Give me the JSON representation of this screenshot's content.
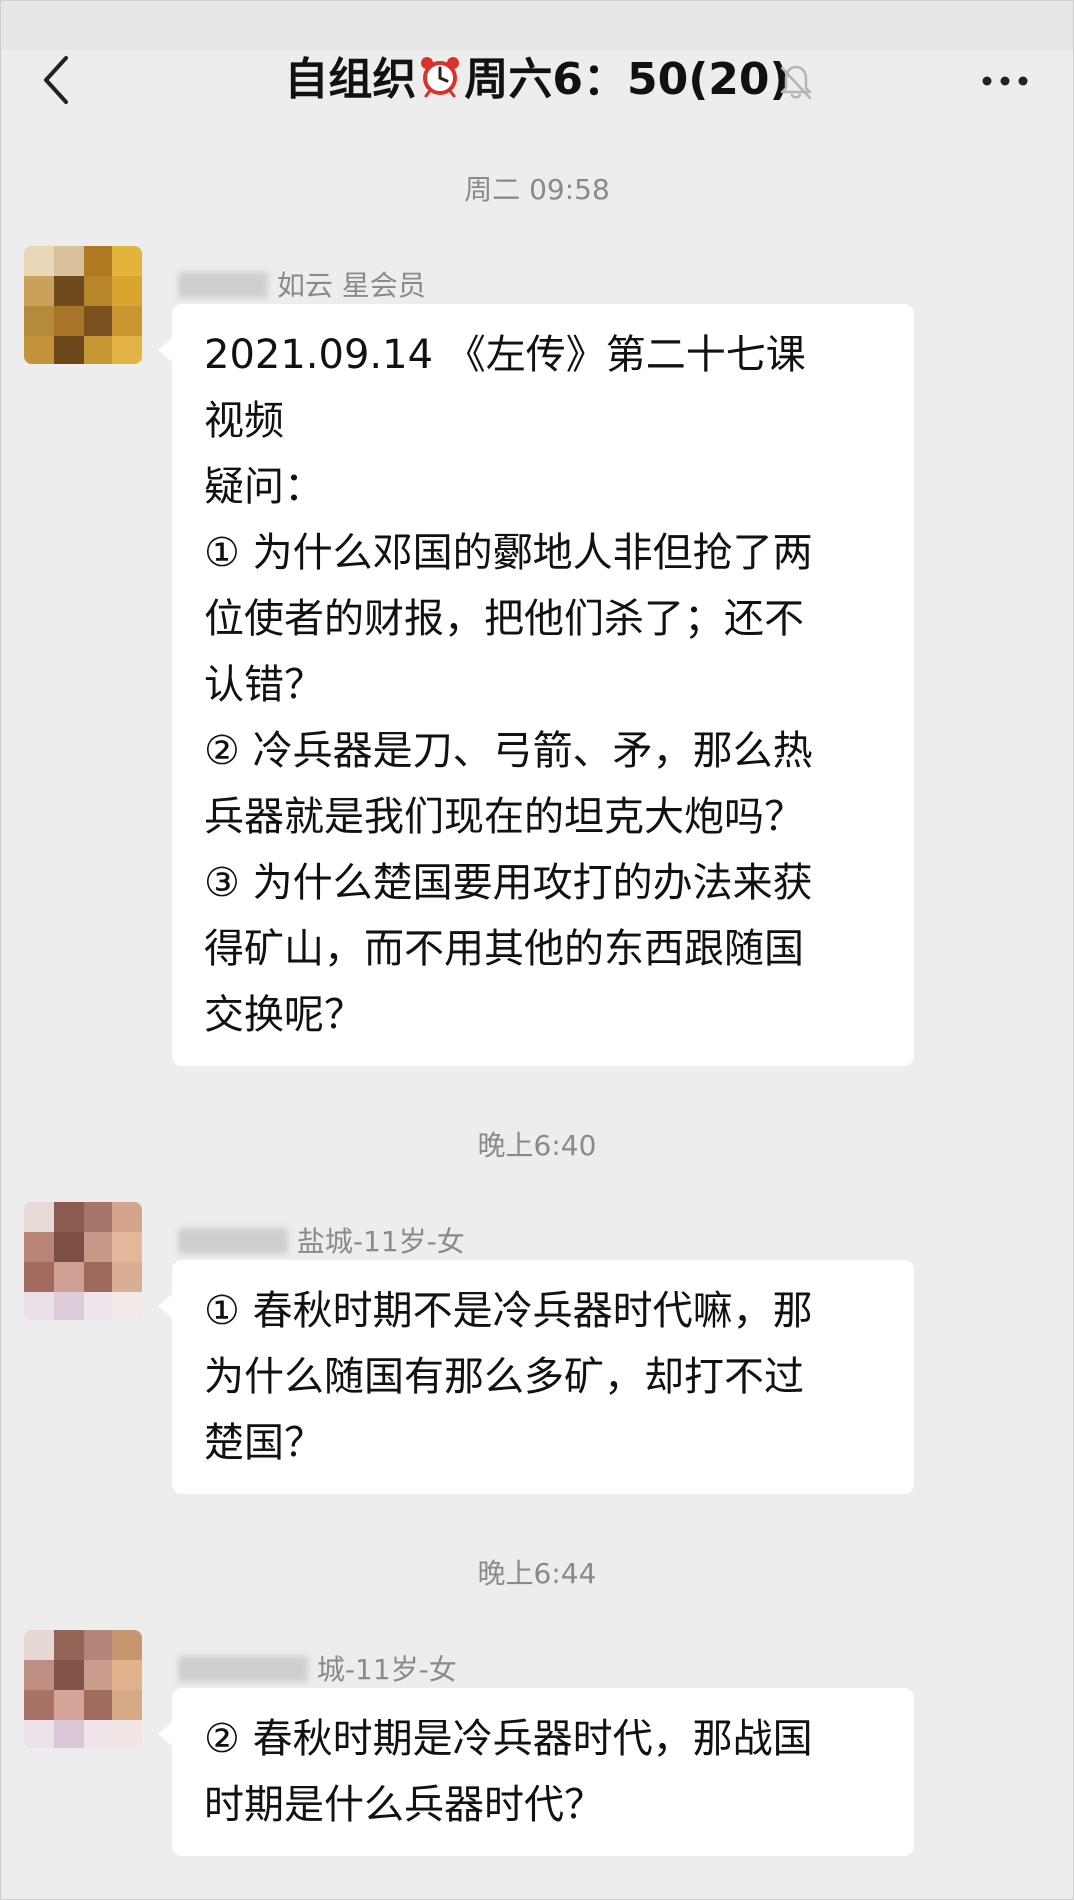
{
  "header": {
    "title_before": "自组织",
    "title_after": "周六6：50(20)",
    "back_icon": "chevron-left-icon",
    "alarm_icon": "alarm-clock-icon",
    "mute_icon": "bell-off-icon",
    "more_icon": "more-dots-icon"
  },
  "messages": [
    {
      "timestamp": "周二 09:58",
      "sender_visible": "如云 星会员",
      "lines": [
        "2021.09.14 《左传》第二十七课",
        "视频",
        "疑问：",
        "① 为什么邓国的鄾地人非但抢了两",
        "位使者的财报，把他们杀了；还不",
        "认错？",
        "② 冷兵器是刀、弓箭、矛，那么热",
        "兵器就是我们现在的坦克大炮吗？",
        "③ 为什么楚国要用攻打的办法来获",
        "得矿山，而不用其他的东西跟随国",
        "交换呢？"
      ]
    },
    {
      "timestamp": "晚上6:40",
      "sender_visible": "盐城-11岁-女",
      "lines": [
        "① 春秋时期不是冷兵器时代嘛，那",
        "为什么随国有那么多矿，却打不过",
        "楚国？"
      ]
    },
    {
      "timestamp": "晚上6:44",
      "sender_visible": "城-11岁-女",
      "lines": [
        "② 春秋时期是冷兵器时代，那战国",
        "时期是什么兵器时代？"
      ]
    }
  ],
  "colors": {
    "background": "#ededed",
    "bubble": "#ffffff",
    "meta_text": "#8a8a8a",
    "body_text": "#111111"
  }
}
